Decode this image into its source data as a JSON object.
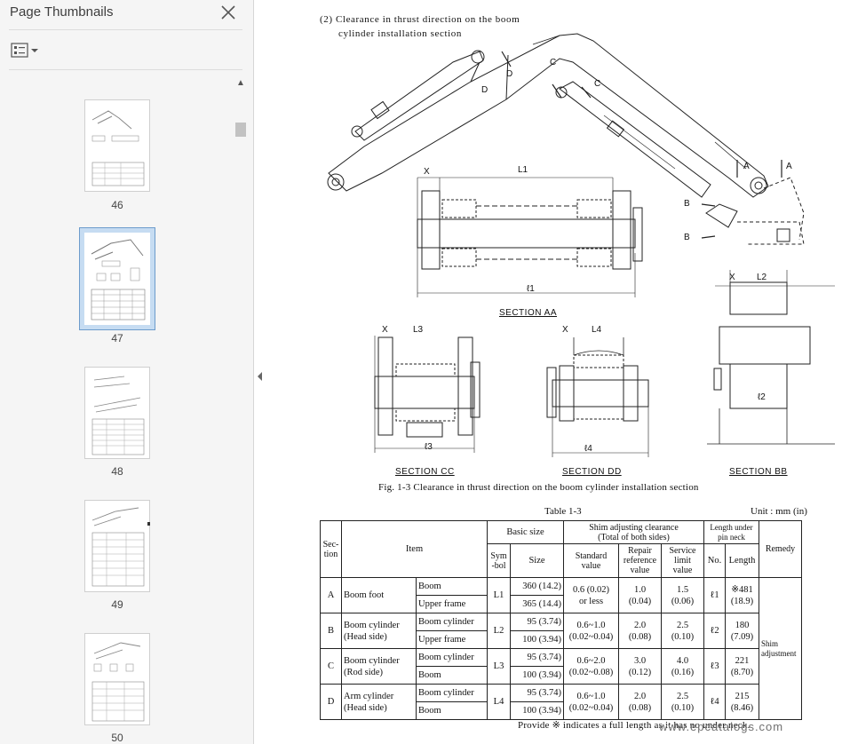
{
  "sidebar": {
    "title": "Page Thumbnails",
    "close_icon": "close-icon",
    "options_icon": "thumbnail-options-icon",
    "thumbnails": [
      {
        "label": "46",
        "selected": false
      },
      {
        "label": "47",
        "selected": true
      },
      {
        "label": "48",
        "selected": false
      },
      {
        "label": "49",
        "selected": false
      },
      {
        "label": "50",
        "selected": false
      }
    ]
  },
  "page": {
    "heading_line1": "(2)  Clearance  in  thrust  direction  on  the  boom",
    "heading_line2": "cylinder installation section",
    "diagram_labels": {
      "c1": "C",
      "c2": "C",
      "d1": "D",
      "d2": "D",
      "a1": "A",
      "a2": "A",
      "b1": "B",
      "b2": "B"
    },
    "section_aa": {
      "title": "SECTION  AA",
      "x": "X",
      "l": "L1",
      "ell": "ℓ1"
    },
    "section_bb": {
      "title": "SECTION  BB",
      "x": "X",
      "l": "L2",
      "ell": "ℓ2"
    },
    "section_cc": {
      "title": "SECTION  CC",
      "x": "X",
      "l": "L3",
      "ell": "ℓ3"
    },
    "section_dd": {
      "title": "SECTION  DD",
      "x": "X",
      "l": "L4",
      "ell": "ℓ4"
    },
    "figure_caption": "Fig. 1-3   Clearance in thrust direction on the boom cylinder installation section",
    "table_caption": "Table 1-3",
    "unit_label": "Unit : mm (in)",
    "table_header": {
      "section": "Sec-\ntion",
      "item": "Item",
      "basic_size": "Basic size",
      "symbol": "Sym\n-bol",
      "size": "Size",
      "shim_clearance": "Shim adjusting clearance\n(Total of both sides)",
      "standard": "Standard\nvalue",
      "repair": "Repair\nreference\nvalue",
      "service": "Service\nlimit\nvalue",
      "length_under": "Length under\npin neck",
      "no": "No.",
      "length": "Length",
      "remedy": "Remedy"
    },
    "table_rows": [
      {
        "sec": "A",
        "item": "Boom foot",
        "sub": [
          "Boom",
          "Upper frame"
        ],
        "sym": "L1",
        "sizes": [
          "360 (14.2)",
          "365 (14.4)"
        ],
        "standard": "0.6 (0.02)\nor less",
        "repair": "1.0\n(0.04)",
        "service": "1.5\n(0.06)",
        "no": "ℓ1",
        "length": "※481\n(18.9)"
      },
      {
        "sec": "B",
        "item": "Boom cylinder\n(Head side)",
        "sub": [
          "Boom cylinder",
          "Upper frame"
        ],
        "sym": "L2",
        "sizes": [
          "95 (3.74)",
          "100 (3.94)"
        ],
        "standard": "0.6~1.0\n(0.02~0.04)",
        "repair": "2.0\n(0.08)",
        "service": "2.5\n(0.10)",
        "no": "ℓ2",
        "length": "180\n(7.09)"
      },
      {
        "sec": "C",
        "item": "Boom cylinder\n(Rod side)",
        "sub": [
          "Boom cylinder",
          "Boom"
        ],
        "sym": "L3",
        "sizes": [
          "95 (3.74)",
          "100 (3.94)"
        ],
        "standard": "0.6~2.0\n(0.02~0.08)",
        "repair": "3.0\n(0.12)",
        "service": "4.0\n(0.16)",
        "no": "ℓ3",
        "length": "221\n(8.70)"
      },
      {
        "sec": "D",
        "item": "Arm cylinder\n(Head side)",
        "sub": [
          "Boom cylinder",
          "Boom"
        ],
        "sym": "L4",
        "sizes": [
          "95 (3.74)",
          "100 (3.94)"
        ],
        "standard": "0.6~1.0\n(0.02~0.04)",
        "repair": "2.0\n(0.08)",
        "service": "2.5\n(0.10)",
        "no": "ℓ4",
        "length": "215\n(8.46)"
      }
    ],
    "remedy_value": "Shim\nadjustment",
    "footer_note": "Provide ※ indicates a full length as it has no under neck.",
    "watermark": "www.epcatalogs.com"
  }
}
